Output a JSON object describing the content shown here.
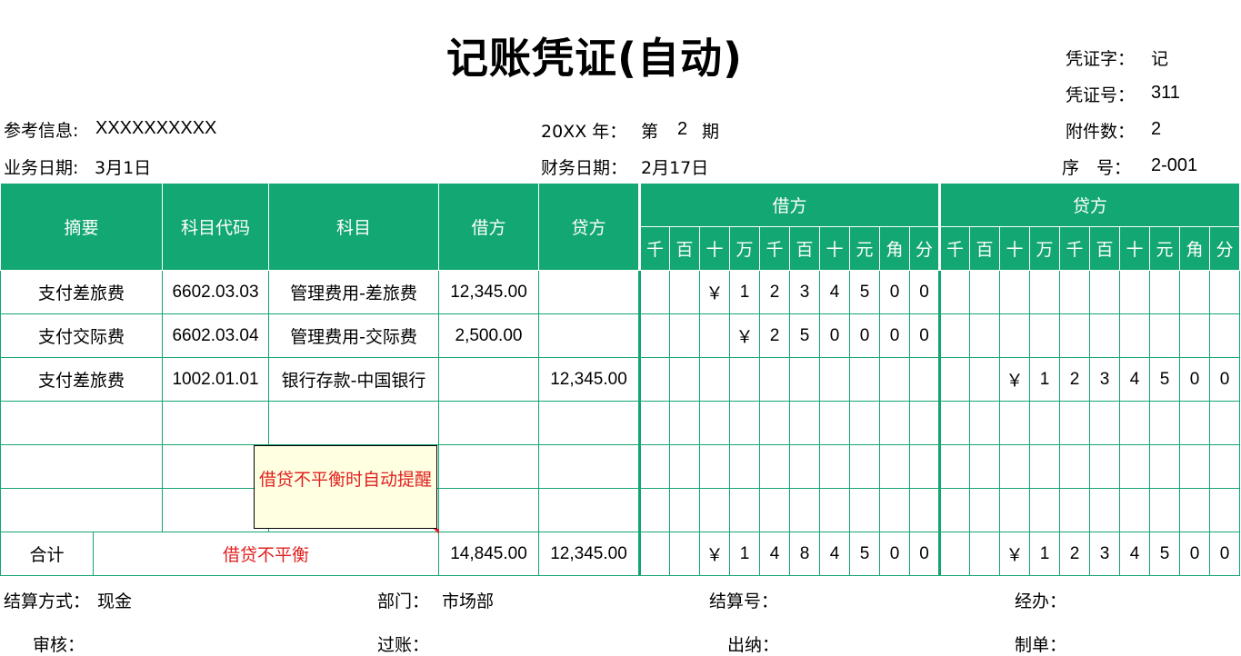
{
  "title": "记账凭证(自动)",
  "meta": {
    "ref_label": "参考信息:",
    "ref_value": "XXXXXXXXXX",
    "biz_date_label": "业务日期:",
    "biz_date_value": "3月1日",
    "year_label": "20XX 年：",
    "period_prefix": "第",
    "period_value": "2",
    "period_suffix": "期",
    "fin_date_label": "财务日期：",
    "fin_date_value": "2月17日",
    "voucher_word_label": "凭证字：",
    "voucher_word_value": "记",
    "voucher_no_label": "凭证号：",
    "voucher_no_value": "311",
    "attach_label": "附件数：",
    "attach_value": "2",
    "seq_label": "序　号：",
    "seq_value": "2-001"
  },
  "table": {
    "headers": {
      "summary": "摘要",
      "code": "科目代码",
      "subject": "科目",
      "debit": "借方",
      "credit": "贷方",
      "debit_group": "借方",
      "credit_group": "贷方",
      "units": [
        "千",
        "百",
        "十",
        "万",
        "千",
        "百",
        "十",
        "元",
        "角",
        "分"
      ]
    },
    "rows": [
      {
        "summary": "支付差旅费",
        "code": "6602.03.03",
        "subject": "管理费用-差旅费",
        "debit": "12,345.00",
        "credit": "",
        "debit_digits": [
          "",
          "",
          "￥",
          "1",
          "2",
          "3",
          "4",
          "5",
          "0",
          "0"
        ],
        "credit_digits": [
          "",
          "",
          "",
          "",
          "",
          "",
          "",
          "",
          "",
          ""
        ]
      },
      {
        "summary": "支付交际费",
        "code": "6602.03.04",
        "subject": "管理费用-交际费",
        "debit": "2,500.00",
        "credit": "",
        "debit_digits": [
          "",
          "",
          "",
          "￥",
          "2",
          "5",
          "0",
          "0",
          "0",
          "0"
        ],
        "credit_digits": [
          "",
          "",
          "",
          "",
          "",
          "",
          "",
          "",
          "",
          ""
        ]
      },
      {
        "summary": "支付差旅费",
        "code": "1002.01.01",
        "subject": "银行存款-中国银行",
        "debit": "",
        "credit": "12,345.00",
        "debit_digits": [
          "",
          "",
          "",
          "",
          "",
          "",
          "",
          "",
          "",
          ""
        ],
        "credit_digits": [
          "",
          "",
          "￥",
          "1",
          "2",
          "3",
          "4",
          "5",
          "0",
          "0"
        ]
      }
    ],
    "total": {
      "label": "合计",
      "warning": "借贷不平衡",
      "debit": "14,845.00",
      "credit": "12,345.00",
      "debit_digits": [
        "",
        "",
        "￥",
        "1",
        "4",
        "8",
        "4",
        "5",
        "0",
        "0"
      ],
      "credit_digits": [
        "",
        "",
        "￥",
        "1",
        "2",
        "3",
        "4",
        "5",
        "0",
        "0"
      ]
    }
  },
  "comment": "借贷不平衡时自动提醒",
  "footer": {
    "settle_method_label": "结算方式：",
    "settle_method_value": "现金",
    "dept_label": "部门：",
    "dept_value": "市场部",
    "settle_no_label": "结算号：",
    "handler_label": "经办：",
    "review_label": "审核：",
    "posting_label": "过账：",
    "cashier_label": "出纳：",
    "maker_label": "制单："
  },
  "colors": {
    "header_green": "#13A773",
    "grid_green": "#13A56F",
    "warning_red": "#E02020",
    "comment_bg": "#FFFFE1"
  }
}
